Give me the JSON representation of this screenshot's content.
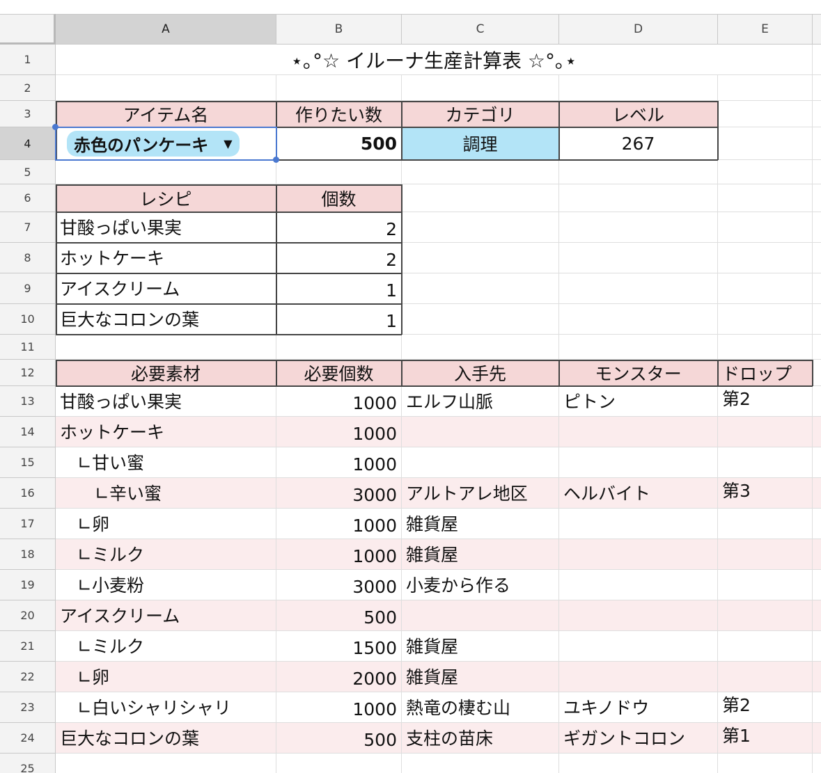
{
  "columns": [
    "A",
    "B",
    "C",
    "D",
    "E"
  ],
  "rows": [
    "1",
    "2",
    "3",
    "4",
    "5",
    "6",
    "7",
    "8",
    "9",
    "10",
    "11",
    "12",
    "13",
    "14",
    "15",
    "16",
    "17",
    "18",
    "19",
    "20",
    "21",
    "22",
    "23",
    "24",
    "25"
  ],
  "title": "⋆｡°☆ イルーナ生産計算表 ☆°｡⋆",
  "header1": {
    "item": "アイテム名",
    "qty": "作りたい数",
    "category": "カテゴリ",
    "level": "レベル"
  },
  "main": {
    "item": "赤色のパンケーキ",
    "qty": "500",
    "category": "調理",
    "level": "267",
    "dropdown_icon": "triangle-down-icon"
  },
  "recipe_header": {
    "name": "レシピ",
    "count": "個数"
  },
  "recipe": [
    {
      "name": "甘酸っぱい果実",
      "count": "2"
    },
    {
      "name": "ホットケーキ",
      "count": "2"
    },
    {
      "name": "アイスクリーム",
      "count": "1"
    },
    {
      "name": "巨大なコロンの葉",
      "count": "1"
    }
  ],
  "materials_header": {
    "material": "必要素材",
    "qty": "必要個数",
    "source": "入手先",
    "monster": "モンスター",
    "drop": "ドロップ"
  },
  "materials": [
    {
      "material": "甘酸っぱい果実",
      "qty": "1000",
      "source": "エルフ山脈",
      "monster": "ピトン",
      "drop": "第2"
    },
    {
      "material": "ホットケーキ",
      "qty": "1000",
      "source": "",
      "monster": "",
      "drop": ""
    },
    {
      "material": "　∟甘い蜜",
      "qty": "1000",
      "source": "",
      "monster": "",
      "drop": ""
    },
    {
      "material": "　　∟辛い蜜",
      "qty": "3000",
      "source": "アルトアレ地区",
      "monster": "ヘルバイト",
      "drop": "第3"
    },
    {
      "material": "　∟卵",
      "qty": "1000",
      "source": "雑貨屋",
      "monster": "",
      "drop": ""
    },
    {
      "material": "　∟ミルク",
      "qty": "1000",
      "source": "雑貨屋",
      "monster": "",
      "drop": ""
    },
    {
      "material": "　∟小麦粉",
      "qty": "3000",
      "source": "小麦から作る",
      "monster": "",
      "drop": ""
    },
    {
      "material": "アイスクリーム",
      "qty": "500",
      "source": "",
      "monster": "",
      "drop": ""
    },
    {
      "material": "　∟ミルク",
      "qty": "1500",
      "source": "雑貨屋",
      "monster": "",
      "drop": ""
    },
    {
      "material": "　∟卵",
      "qty": "2000",
      "source": "雑貨屋",
      "monster": "",
      "drop": ""
    },
    {
      "material": "　∟白いシャリシャリ",
      "qty": "1000",
      "source": "熱竜の棲む山",
      "monster": "ユキノドウ",
      "drop": "第2"
    },
    {
      "material": "巨大なコロンの葉",
      "qty": "500",
      "source": "支柱の苗床",
      "monster": "ギガントコロン",
      "drop": "第1"
    }
  ],
  "colors": {
    "header_pink": "#f5d7d7",
    "row_pink": "#fbeced",
    "category_blue": "#b3e4f7",
    "selection": "#4a78d0"
  }
}
